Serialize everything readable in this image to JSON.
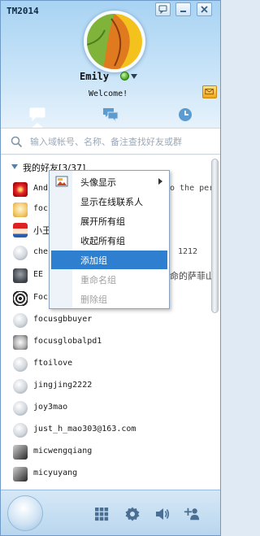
{
  "window": {
    "title": "TM2014"
  },
  "profile": {
    "username": "Emily",
    "signature": "Welcome!",
    "status": "online"
  },
  "tabs": [
    {
      "name": "contacts",
      "icon": "chat-bubble-icon",
      "active": true
    },
    {
      "name": "groups",
      "icon": "group-chat-icon",
      "active": false
    },
    {
      "name": "recent",
      "icon": "clock-icon",
      "active": false
    }
  ],
  "search": {
    "placeholder": "输入域帐号、名称、备注查找好友或群"
  },
  "group": {
    "label": "我的好友[3/37]"
  },
  "contacts": [
    {
      "name": "And",
      "extra": "o the per",
      "avatar": "red-flower"
    },
    {
      "name": "foc",
      "extra": "",
      "avatar": "smiley-face"
    },
    {
      "name": "小王",
      "extra": "",
      "avatar": "doll"
    },
    {
      "name": "che",
      "extra": "1212",
      "avatar": "globe"
    },
    {
      "name": "EE",
      "extra": "命的萨菲山",
      "avatar": "dark-photo"
    },
    {
      "name": "Foc",
      "extra": "",
      "avatar": "spiral"
    },
    {
      "name": "focusgbbuyer",
      "extra": "",
      "avatar": "globe"
    },
    {
      "name": "focusglobalpd1",
      "extra": "",
      "avatar": "cat"
    },
    {
      "name": "ftoilove",
      "extra": "",
      "avatar": "globe"
    },
    {
      "name": "jingjing2222",
      "extra": "",
      "avatar": "globe"
    },
    {
      "name": "joy3mao",
      "extra": "",
      "avatar": "globe"
    },
    {
      "name": "just_h_mao303@163.com",
      "extra": "",
      "avatar": "globe"
    },
    {
      "name": "micwengqiang",
      "extra": "",
      "avatar": "bw-photo"
    },
    {
      "name": "micyuyang",
      "extra": "",
      "avatar": "bw-photo"
    }
  ],
  "context_menu": {
    "items": [
      {
        "label": "头像显示",
        "has_submenu": true,
        "state": "normal"
      },
      {
        "label": "显示在线联系人",
        "has_submenu": false,
        "state": "normal"
      },
      {
        "label": "展开所有组",
        "has_submenu": false,
        "state": "normal"
      },
      {
        "label": "收起所有组",
        "has_submenu": false,
        "state": "normal"
      },
      {
        "label": "添加组",
        "has_submenu": false,
        "state": "highlighted"
      },
      {
        "label": "重命名组",
        "has_submenu": false,
        "state": "disabled"
      },
      {
        "label": "删除组",
        "has_submenu": false,
        "state": "disabled"
      }
    ]
  },
  "bottom_bar": {
    "icons": [
      "apps-grid-icon",
      "settings-gear-icon",
      "volume-icon",
      "add-user-icon"
    ]
  },
  "colors": {
    "highlight": "#2e7fcf",
    "online": "#45a51c",
    "accent": "#6f9ac7"
  }
}
